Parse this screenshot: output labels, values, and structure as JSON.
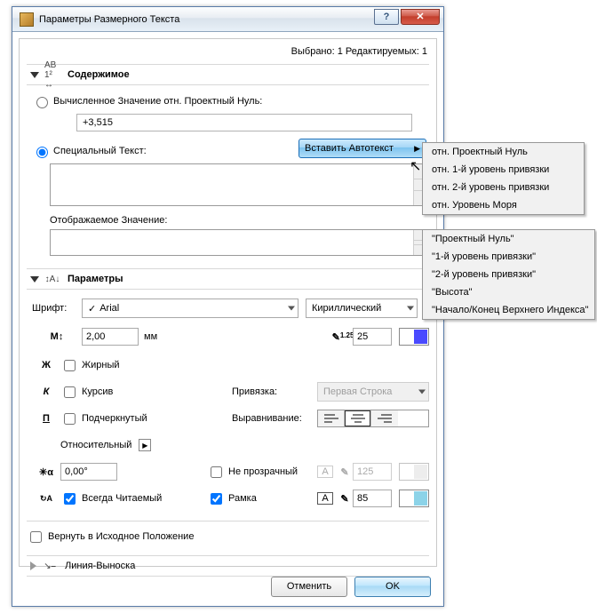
{
  "window": {
    "title": "Параметры Размерного Текста"
  },
  "status": "Выбрано: 1 Редактируемых: 1",
  "content": {
    "section_title": "Содержимое",
    "radio_computed": "Вычисленное Значение отн. Проектный Нуль:",
    "computed_value": "+3,515",
    "radio_special": "Специальный Текст:",
    "autotext_btn": "Вставить Автотекст",
    "displayed_label": "Отображаемое Значение:"
  },
  "params": {
    "section_title": "Параметры",
    "font_label": "Шрифт:",
    "font_value": "Arial",
    "script_value": "Кириллический",
    "size_value": "2,00",
    "size_unit": "мм",
    "pen_value": "25",
    "bold": "Жирный",
    "italic": "Курсив",
    "underline": "Подчеркнутый",
    "anchor_label": "Привязка:",
    "anchor_value": "Первая Строка",
    "align_label": "Выравнивание:",
    "relative_label": "Относительный",
    "angle_value": "0,00°",
    "opaque_label": "Не прозрачный",
    "opaque_pen": "125",
    "always_readable": "Всегда Читаемый",
    "frame_label": "Рамка",
    "frame_pen": "85"
  },
  "reset": {
    "label": "Вернуть в Исходное Положение"
  },
  "leader": {
    "section_title": "Линия-Выноска"
  },
  "buttons": {
    "cancel": "Отменить",
    "ok": "OK"
  },
  "popup1": {
    "items": [
      "отн. Проектный Нуль",
      "отн. 1-й уровень привязки",
      "отн. 2-й уровень привязки",
      "отн. Уровень Моря"
    ]
  },
  "popup2": {
    "items": [
      "\"Проектный Нуль\"",
      "\"1-й уровень привязки\"",
      "\"2-й уровень привязки\"",
      "\"Высота\"",
      "\"Начало/Конец Верхнего Индекса\""
    ]
  }
}
